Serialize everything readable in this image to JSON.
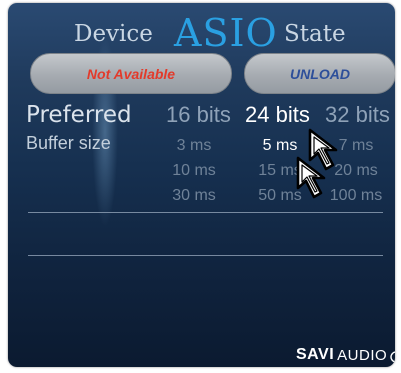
{
  "header": {
    "device_label": "Device",
    "asio_label": "ASIO",
    "state_label": "State"
  },
  "buttons": {
    "status_label": "Not Available",
    "unload_label": "UNLOAD"
  },
  "preferred": {
    "label": "Preferred",
    "bit_options": [
      "16 bits",
      "24 bits",
      "32 bits"
    ],
    "selected": "24 bits"
  },
  "buffer": {
    "label": "Buffer size",
    "options": [
      "3 ms",
      "5 ms",
      "7 ms",
      "10 ms",
      "15 ms",
      "20 ms",
      "30 ms",
      "50 ms",
      "100 ms"
    ],
    "selected": "5 ms"
  },
  "logo": {
    "part1": "SAVI",
    "part2": "AUDIO"
  },
  "colors": {
    "asio_accent": "#2aa0e2",
    "not_available": "#e33a2a",
    "unload": "#2d4f9a"
  }
}
